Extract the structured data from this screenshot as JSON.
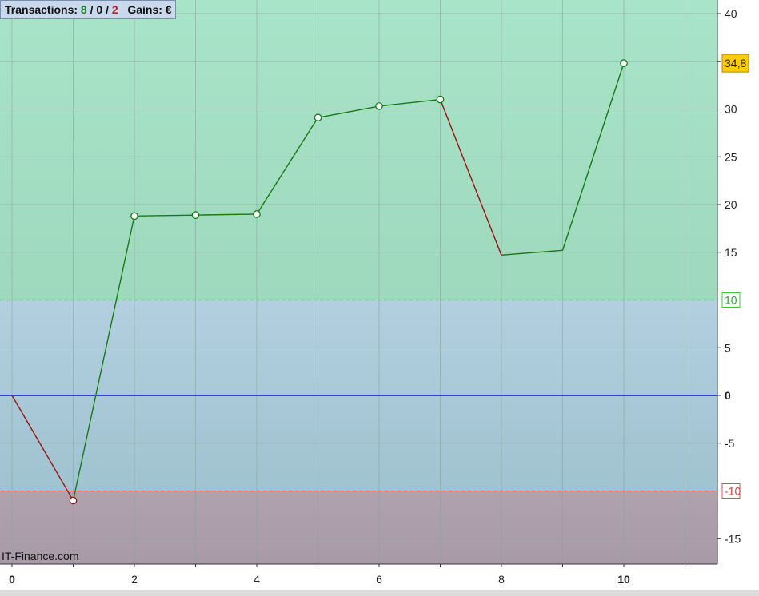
{
  "header": {
    "transactions_label": "Transactions:",
    "winning": "8",
    "neutral": "0",
    "losing": "2",
    "sep": "/",
    "gains_label": "Gains: €"
  },
  "watermark": "IT-Finance.com",
  "colors": {
    "zone_gain": "#9fd9bd",
    "zone_neutral": "#b3cfe0",
    "zone_loss": "#b0a2ad",
    "line_up": "#167a16",
    "line_down": "#9b1010",
    "zero_line": "#1010d8",
    "upper_threshold": "#33cc33",
    "lower_threshold": "#e05050",
    "last_value_badge": "#ffcc00"
  },
  "chart_data": {
    "type": "line",
    "x": [
      0,
      1,
      2,
      3,
      4,
      5,
      6,
      7,
      8,
      9,
      10
    ],
    "values": [
      0,
      -11,
      18.8,
      18.9,
      19.0,
      29.1,
      30.3,
      31.0,
      14.7,
      15.2,
      34.8
    ],
    "markers": [
      false,
      true,
      true,
      true,
      true,
      true,
      true,
      true,
      false,
      false,
      true
    ],
    "xlim": [
      0,
      11.5
    ],
    "ylim": [
      -17.5,
      41.5
    ],
    "x_ticks": [
      "0",
      "2",
      "4",
      "6",
      "8",
      "10"
    ],
    "y_ticks": [
      "40",
      "35",
      "30",
      "25",
      "20",
      "15",
      "10",
      "5",
      "0",
      "-5",
      "-10",
      "-15"
    ],
    "upper_threshold": 10,
    "lower_threshold": -10,
    "last_value_label": "34,8",
    "grid": true,
    "y_axis_position": "right"
  }
}
